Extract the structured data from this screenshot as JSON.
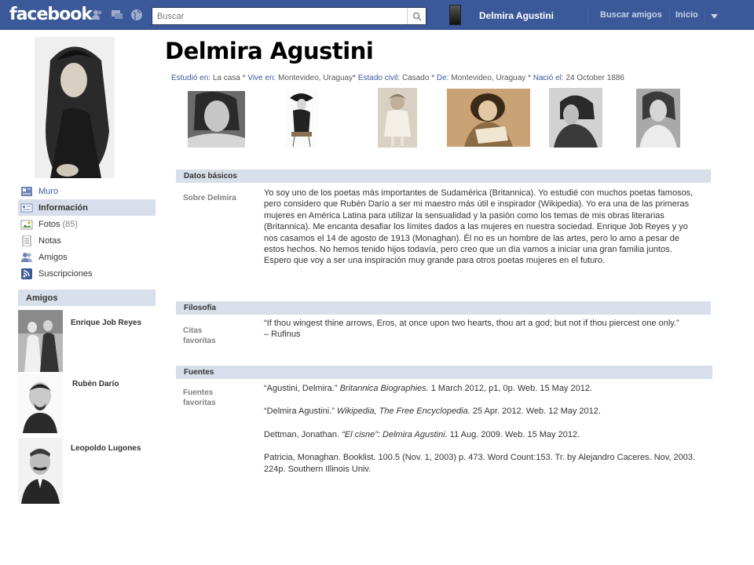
{
  "topbar": {
    "logo": "facebook",
    "search_placeholder": "Buscar",
    "user_name": "Delmira Agustini",
    "find_friends": "Buscar amigos",
    "home": "Inicio",
    "bg_color": "#3b5998"
  },
  "sidebar": {
    "items": [
      {
        "label": "Muro",
        "icon": "wall-icon"
      },
      {
        "label": "Información",
        "icon": "info-icon",
        "active": true
      },
      {
        "label": "Fotos",
        "count": "(85)",
        "icon": "photos-icon"
      },
      {
        "label": "Notas",
        "icon": "notes-icon"
      },
      {
        "label": "Amigos",
        "icon": "friends-icon"
      },
      {
        "label": "Suscripciones",
        "icon": "subscriptions-icon"
      }
    ],
    "friends_header": "Amigos",
    "friends": [
      {
        "name": "Enrique Job Reyes"
      },
      {
        "name": "Rubén Darío"
      },
      {
        "name": "Leopoldo Lugones"
      }
    ]
  },
  "profile": {
    "name": "Delmira Agustini",
    "info": {
      "studied_label": "Estudió en:",
      "studied": "La casa",
      "lives_label": "Vive en:",
      "lives": "Montevideo, Uraguay",
      "status_label": "Estado civil:",
      "status": "Casado",
      "from_label": "De:",
      "from": "Montevideo, Uraguay",
      "born_label": "Nació el:",
      "born": "24 October 1886"
    }
  },
  "sections": {
    "basic": {
      "header": "Datos básicos",
      "label": "Sobre Delmira",
      "text": "Yo soy uno de los poetas más importantes de Sudamérica (Britannica).  Yo estudié con muchos poetas famosos, pero considero que Rubén Darío a ser mi maestro más útil e inspirador (Wikipedia).  Yo era una de las primeras mujeres en América Latina para utilizar la sensualidad y la pasión como los temas de mis obras literarias (Britannica).  Me encanta desafiar los límites dados a las mujeres en nuestra sociedad. Enrique Job Reyes y yo nos casamos el 14 de agosto de 1913 (Monaghan).  Él no es un hombre de las artes, pero lo amo a pesar de estos hechos. No hemos tenido hijos todavía, pero creo que un día vamos a iniciar una gran familia juntos. Espero que voy a ser una inspiración muy grande para otros poetas mujeres en el futuro."
    },
    "philosophy": {
      "header": "Filosofía",
      "label_line1": "Citas",
      "label_line2": "favoritas",
      "quote": "“If thou wingest thine arrows, Eros, at once upon two hearts, thou art a god; but not if thou piercest one only.”",
      "author": "– Rufinus"
    },
    "sources": {
      "header": "Fuentes",
      "label_line1": "Fuentes",
      "label_line2": "favoritas",
      "s1a": "“Agustini, Delmira.” ",
      "s1b": "Britannica Biographies.",
      "s1c": "  1 March 2012, p1, 0p.  Web.  15 May 2012.",
      "s2a": "“Delmira Agustini.” ",
      "s2b": "Wikipedia, The Free Encyclopedia.",
      "s2c": "  25 Apr. 2012. Web.  12 May 2012.",
      "s3a": "Dettman, Jonathan.  ",
      "s3b": "“El cisne”: Delmira Agustini.",
      "s3c": "  11 Aug. 2009.  Web.  15 May 2012.",
      "s4": "Patricia, Monaghan.  Booklist.  100.5 (Nov. 1, 2003) p. 473.  Word Count:153.  Tr. by Alejandro Caceres.  Nov, 2003.  224p.  Southern Illinois Univ."
    }
  }
}
